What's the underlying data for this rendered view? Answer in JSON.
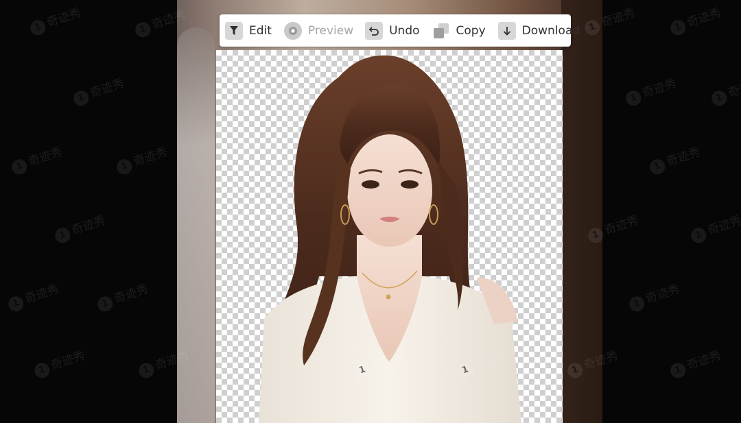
{
  "toolbar": {
    "buttons": [
      {
        "label": "Edit",
        "icon": "filter-icon",
        "enabled": true
      },
      {
        "label": "Preview",
        "icon": "eye-icon",
        "enabled": false
      },
      {
        "label": "Undo",
        "icon": "undo-icon",
        "enabled": true
      },
      {
        "label": "Copy",
        "icon": "copy-icon",
        "enabled": true
      },
      {
        "label": "Download",
        "icon": "download-icon",
        "enabled": true
      }
    ]
  },
  "watermark": {
    "text": "奇迹秀",
    "logo": "1"
  },
  "colors": {
    "transparency_check": "#cfcfcf",
    "toolbar_bg": "#ffffff",
    "icon_bg": "#d7d7d7",
    "page_bg": "#060606"
  }
}
